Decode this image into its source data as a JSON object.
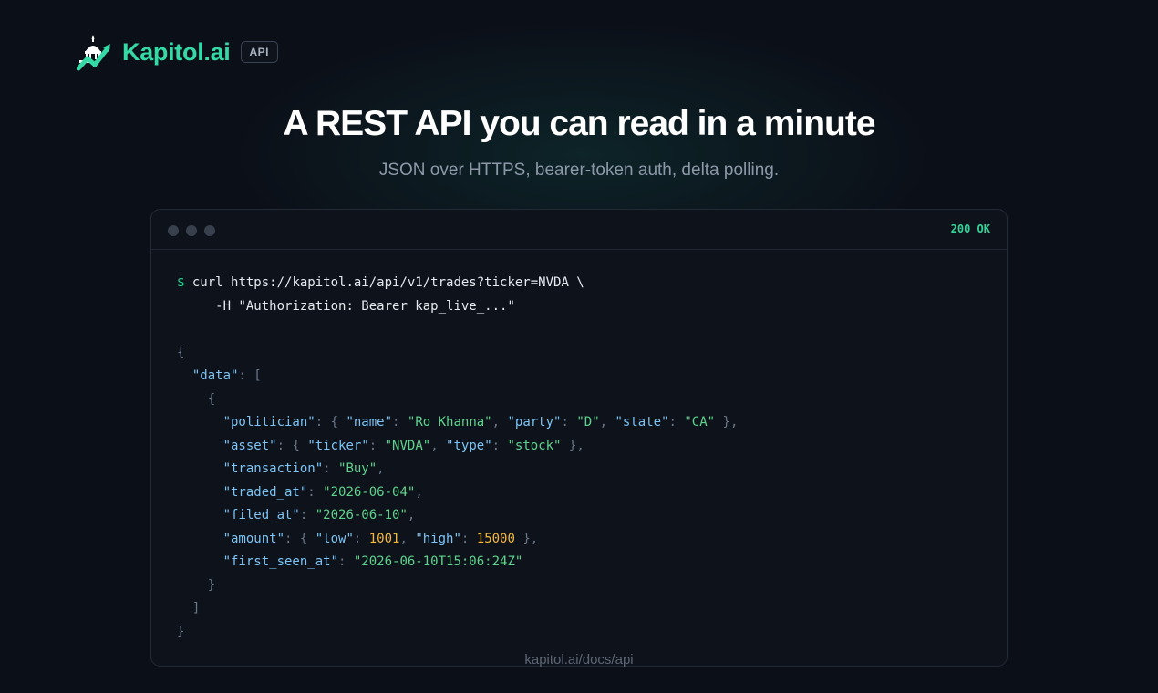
{
  "brand": {
    "name": "Kapitol.ai",
    "badge": "API",
    "logo_icon": "capitol-dome-chart-icon",
    "accent_color": "#34d9a5"
  },
  "hero": {
    "headline": "A REST API you can read in a minute",
    "subline": "JSON over HTTPS, bearer-token auth, delta polling."
  },
  "terminal": {
    "status": "200 OK",
    "status_color": "#34d399",
    "command": {
      "prompt": "$",
      "line1": "curl https://kapitol.ai/api/v1/trades?ticker=NVDA \\",
      "line2": "-H \"Authorization: Bearer kap_live_...\""
    },
    "response": {
      "data_key": "\"data\"",
      "politician_key": "\"politician\"",
      "name_key": "\"name\"",
      "name_val": "\"Ro Khanna\"",
      "party_key": "\"party\"",
      "party_val": "\"D\"",
      "state_key": "\"state\"",
      "state_val": "\"CA\"",
      "asset_key": "\"asset\"",
      "ticker_key": "\"ticker\"",
      "ticker_val": "\"NVDA\"",
      "type_key": "\"type\"",
      "type_val": "\"stock\"",
      "transaction_key": "\"transaction\"",
      "transaction_val": "\"Buy\"",
      "traded_at_key": "\"traded_at\"",
      "traded_at_val": "\"2026-06-04\"",
      "filed_at_key": "\"filed_at\"",
      "filed_at_val": "\"2026-06-10\"",
      "amount_key": "\"amount\"",
      "low_key": "\"low\"",
      "low_val": "1001",
      "high_key": "\"high\"",
      "high_val": "15000",
      "first_seen_key": "\"first_seen_at\"",
      "first_seen_val": "\"2026-06-10T15:06:24Z\""
    }
  },
  "footer": {
    "docs_link": "kapitol.ai/docs/api"
  }
}
